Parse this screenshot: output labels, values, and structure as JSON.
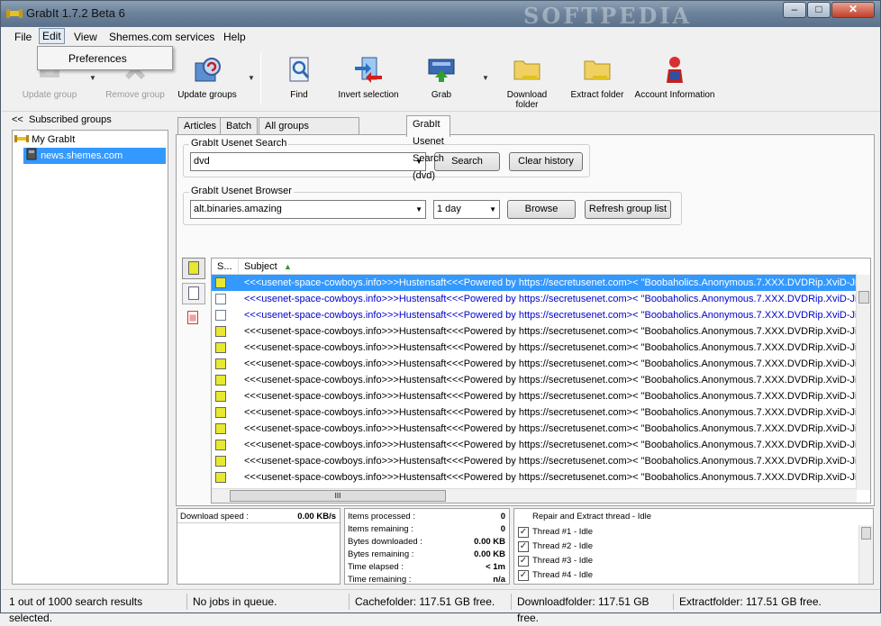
{
  "window": {
    "title": "GrabIt 1.7.2 Beta 6",
    "watermark": "SOFTPEDIA",
    "minimize": "–",
    "maximize": "□",
    "close": "✕"
  },
  "menu": {
    "file": "File",
    "edit": "Edit",
    "view": "View",
    "shemes": "Shemes.com services",
    "help": "Help"
  },
  "edit_menu": {
    "preferences": "Preferences"
  },
  "toolbar": {
    "update_group": "Update group",
    "remove_group": "Remove group",
    "update_groups": "Update groups",
    "find": "Find",
    "invert_selection": "Invert selection",
    "grab": "Grab",
    "download_folder": "Download folder",
    "extract_folder": "Extract folder",
    "account_information": "Account Information"
  },
  "left_panel": {
    "collapse": "<<",
    "header": "Subscribed groups",
    "root": "My GrabIt",
    "server": "news.shemes.com"
  },
  "tabs": [
    "Articles",
    "Batch",
    "All groups (news.shemes.com)",
    "GrabIt Usenet Search (dvd)"
  ],
  "search": {
    "group_label": "GrabIt Usenet Search",
    "query": "dvd",
    "search_button": "Search",
    "clear_button": "Clear history"
  },
  "browser": {
    "group_label": "GrabIt Usenet Browser",
    "group": "alt.binaries.amazing",
    "period": "1 day",
    "browse_button": "Browse",
    "refresh_button": "Refresh group list"
  },
  "results": {
    "col_status": "S...",
    "col_subject": "Subject",
    "rows": [
      {
        "subject": "<<<usenet-space-cowboys.info>>>Hustensaft<<<Powered by https://secretusenet.com>< \"Boobaholics.Anonymous.7.XXX.DVDRip.XviD-Jiggly",
        "state": "sel"
      },
      {
        "subject": "<<<usenet-space-cowboys.info>>>Hustensaft<<<Powered by https://secretusenet.com>< \"Boobaholics.Anonymous.7.XXX.DVDRip.XviD-Jiggly",
        "state": "blue"
      },
      {
        "subject": "<<<usenet-space-cowboys.info>>>Hustensaft<<<Powered by https://secretusenet.com>< \"Boobaholics.Anonymous.7.XXX.DVDRip.XviD-Jiggly",
        "state": "blue"
      },
      {
        "subject": "<<<usenet-space-cowboys.info>>>Hustensaft<<<Powered by https://secretusenet.com>< \"Boobaholics.Anonymous.7.XXX.DVDRip.XviD-Jiggly",
        "state": "y"
      },
      {
        "subject": "<<<usenet-space-cowboys.info>>>Hustensaft<<<Powered by https://secretusenet.com>< \"Boobaholics.Anonymous.7.XXX.DVDRip.XviD-Jiggly",
        "state": "y"
      },
      {
        "subject": "<<<usenet-space-cowboys.info>>>Hustensaft<<<Powered by https://secretusenet.com>< \"Boobaholics.Anonymous.7.XXX.DVDRip.XviD-Jiggly",
        "state": "y"
      },
      {
        "subject": "<<<usenet-space-cowboys.info>>>Hustensaft<<<Powered by https://secretusenet.com>< \"Boobaholics.Anonymous.7.XXX.DVDRip.XviD-Jiggly",
        "state": "y"
      },
      {
        "subject": "<<<usenet-space-cowboys.info>>>Hustensaft<<<Powered by https://secretusenet.com>< \"Boobaholics.Anonymous.7.XXX.DVDRip.XviD-Jiggly",
        "state": "y"
      },
      {
        "subject": "<<<usenet-space-cowboys.info>>>Hustensaft<<<Powered by https://secretusenet.com>< \"Boobaholics.Anonymous.7.XXX.DVDRip.XviD-Jiggly",
        "state": "y"
      },
      {
        "subject": "<<<usenet-space-cowboys.info>>>Hustensaft<<<Powered by https://secretusenet.com>< \"Boobaholics.Anonymous.7.XXX.DVDRip.XviD-Jiggly",
        "state": "y"
      },
      {
        "subject": "<<<usenet-space-cowboys.info>>>Hustensaft<<<Powered by https://secretusenet.com>< \"Boobaholics.Anonymous.7.XXX.DVDRip.XviD-Jiggly",
        "state": "y"
      },
      {
        "subject": "<<<usenet-space-cowboys.info>>>Hustensaft<<<Powered by https://secretusenet.com>< \"Boobaholics.Anonymous.7.XXX.DVDRip.XviD-Jiggly",
        "state": "y"
      },
      {
        "subject": "<<<usenet-space-cowboys.info>>>Hustensaft<<<Powered by https://secretusenet.com>< \"Boobaholics.Anonymous.7.XXX.DVDRip.XviD-Jiggly",
        "state": "y"
      },
      {
        "subject": "<<<usenet-space-cowboys.info>>>Hustensaft<<<Powered by https://secretusenet.com>< \"Boobaholics.Anonymous.7.XXX.DVDRip.XviD-Jiggly",
        "state": "y"
      },
      {
        "subject": "<<<usenet-space-cowboys.info>>>Hustensaft<<<Powered by https://secretusenet.com>< \"Boobaholics.Anonymous.7.XXX.DVDRip.XviD-Jiggly",
        "state": "y"
      }
    ],
    "hscroll_grip": "III"
  },
  "download": {
    "speed_label": "Download speed :",
    "speed_value": "0.00 KB/s"
  },
  "stats": [
    {
      "label": "Items processed :",
      "value": "0"
    },
    {
      "label": "Items remaining :",
      "value": "0"
    },
    {
      "label": "Bytes downloaded :",
      "value": "0.00 KB"
    },
    {
      "label": "Bytes remaining :",
      "value": "0.00 KB"
    },
    {
      "label": "Time elapsed :",
      "value": "< 1m"
    },
    {
      "label": "Time remaining :",
      "value": "n/a"
    }
  ],
  "threads": {
    "header": "Repair and Extract thread - Idle",
    "items": [
      "Thread #1 - Idle",
      "Thread #2 - Idle",
      "Thread #3 - Idle",
      "Thread #4 - Idle"
    ]
  },
  "status": {
    "selected": "1 out of 1000 search results selected.",
    "jobs": "No jobs in queue.",
    "cache": "Cachefolder: 117.51 GB free.",
    "download": "Downloadfolder: 117.51 GB free.",
    "extract": "Extractfolder: 117.51 GB free."
  }
}
